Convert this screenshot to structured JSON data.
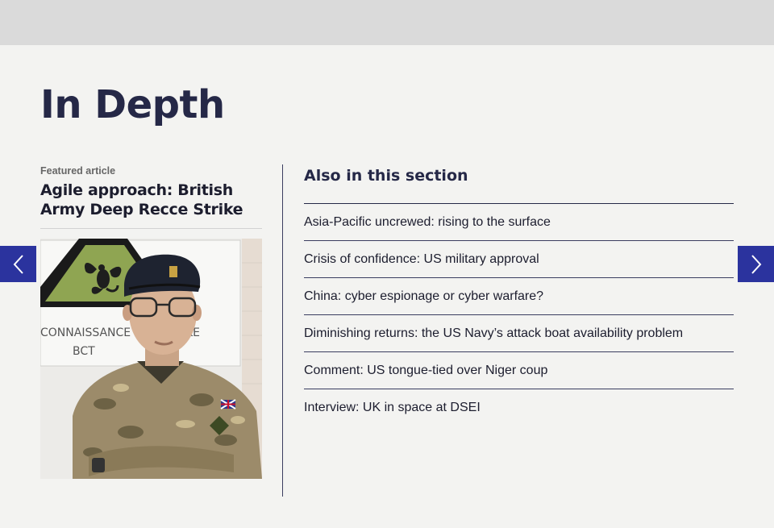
{
  "section": {
    "title": "In Depth"
  },
  "featured": {
    "label": "Featured article",
    "title": "Agile approach: British Army Deep Recce Strike",
    "image_sign_line1": "CONNAISSANCE",
    "image_sign_line1b": "KE",
    "image_sign_line2": "BCT"
  },
  "also": {
    "title": "Also in this section",
    "items": [
      "Asia-Pacific uncrewed: rising to the surface",
      "Crisis of confidence: US military approval",
      "China: cyber espionage or cyber warfare?",
      "Diminishing returns: the US Navy’s attack boat availability problem",
      "Comment: US tongue-tied over Niger coup",
      "Interview: UK in space at DSEI"
    ]
  },
  "nav": {
    "prev_icon": "chevron-left-icon",
    "next_icon": "chevron-right-icon"
  },
  "colors": {
    "accent": "#2b339e",
    "heading": "#252847",
    "background": "#f3f3f1",
    "topbar": "#dadada"
  }
}
